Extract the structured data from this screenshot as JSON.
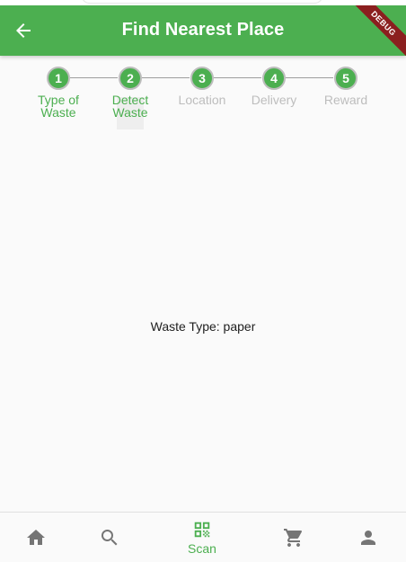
{
  "app_bar": {
    "title": "Find Nearest Place",
    "debug_badge": "DEBUG",
    "back_icon": "arrow-back-icon",
    "color": "#4caf50"
  },
  "stepper": {
    "steps": [
      {
        "number": "1",
        "label_line1": "Type of",
        "label_line2": "Waste",
        "state": "completed"
      },
      {
        "number": "2",
        "label_line1": "Detect",
        "label_line2": "Waste",
        "state": "current"
      },
      {
        "number": "3",
        "label_line1": "Location",
        "label_line2": "",
        "state": "upcoming"
      },
      {
        "number": "4",
        "label_line1": "Delivery",
        "label_line2": "",
        "state": "upcoming"
      },
      {
        "number": "5",
        "label_line1": "Reward",
        "label_line2": "",
        "state": "upcoming"
      }
    ],
    "active_color": "#4caf50",
    "inactive_color": "#bdbdbd"
  },
  "content": {
    "waste_type_text": "Waste Type: paper"
  },
  "bottom_nav": {
    "items": [
      {
        "icon": "home-icon",
        "label": ""
      },
      {
        "icon": "search-icon",
        "label": ""
      },
      {
        "icon": "qr-code-icon",
        "label": "Scan",
        "selected": true
      },
      {
        "icon": "cart-icon",
        "label": ""
      },
      {
        "icon": "person-icon",
        "label": ""
      }
    ],
    "selected_color": "#4caf50",
    "unselected_color": "#757575"
  }
}
